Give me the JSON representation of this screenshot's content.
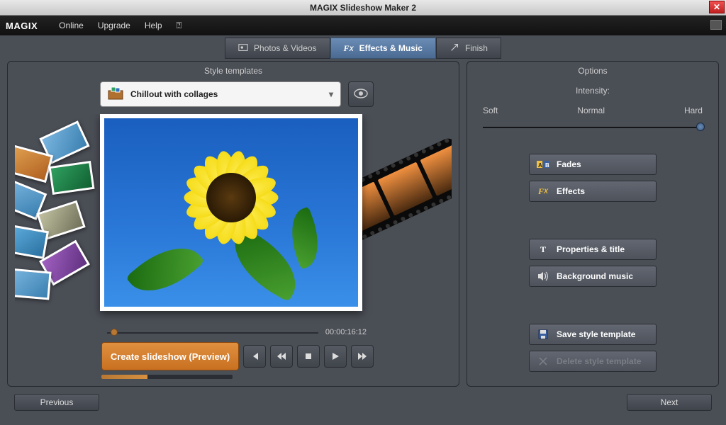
{
  "window": {
    "title": "MAGIX Slideshow Maker 2"
  },
  "menubar": {
    "logo": "MAGIX",
    "items": [
      "Online",
      "Upgrade",
      "Help"
    ]
  },
  "maintabs": [
    {
      "id": "photos",
      "label": "Photos & Videos",
      "active": false
    },
    {
      "id": "effects",
      "label": "Effects & Music",
      "active": true
    },
    {
      "id": "finish",
      "label": "Finish",
      "active": false
    }
  ],
  "panels": {
    "left_title": "Style templates",
    "right_title": "Options"
  },
  "template": {
    "selected": "Chillout with collages"
  },
  "timeline": {
    "timecode": "00:00:16:12"
  },
  "create_button": "Create slideshow (Preview)",
  "options": {
    "intensity_label": "Intensity:",
    "ticks": {
      "soft": "Soft",
      "normal": "Normal",
      "hard": "Hard"
    },
    "intensity_value": "hard",
    "buttons": {
      "fades": "Fades",
      "effects": "Effects",
      "properties": "Properties & title",
      "music": "Background music",
      "save": "Save style template",
      "delete": "Delete style template"
    }
  },
  "footer": {
    "prev": "Previous",
    "next": "Next"
  }
}
